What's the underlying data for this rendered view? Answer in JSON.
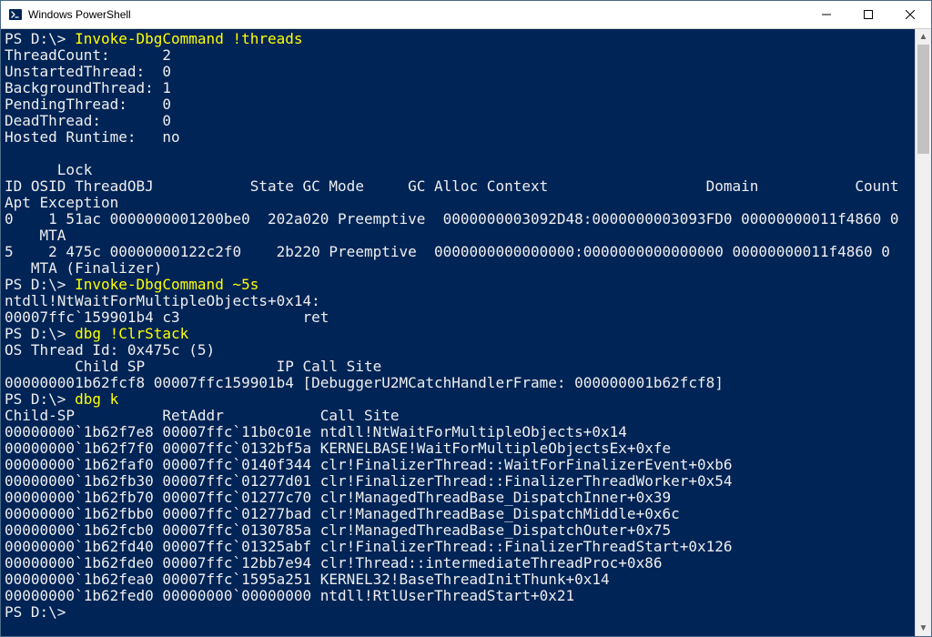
{
  "window": {
    "title": "Windows PowerShell"
  },
  "colors": {
    "terminal_bg": "#012456",
    "terminal_fg": "#eeeeee",
    "command_fg": "#ffff00"
  },
  "terminal": {
    "lines": [
      {
        "prompt": "PS D:\\> ",
        "cmd": "Invoke-DbgCommand !threads"
      },
      {
        "out": "ThreadCount:      2"
      },
      {
        "out": "UnstartedThread:  0"
      },
      {
        "out": "BackgroundThread: 1"
      },
      {
        "out": "PendingThread:    0"
      },
      {
        "out": "DeadThread:       0"
      },
      {
        "out": "Hosted Runtime:   no"
      },
      {
        "out": "                                                                                                             Lock "
      },
      {
        "out": "ID OSID ThreadOBJ           State GC Mode     GC Alloc Context                  Domain           Count Apt Exception"
      },
      {
        "out": "0    1 51ac 0000000001200be0  202a020 Preemptive  0000000003092D48:0000000003093FD0 00000000011f4860 0     MTA"
      },
      {
        "out": "5    2 475c 00000000122c2f0    2b220 Preemptive  0000000000000000:0000000000000000 00000000011f4860 0     MTA (Finalizer)"
      },
      {
        "prompt": "PS D:\\> ",
        "cmd": "Invoke-DbgCommand ~5s"
      },
      {
        "out": "ntdll!NtWaitForMultipleObjects+0x14:"
      },
      {
        "out": "00007ffc`159901b4 c3              ret"
      },
      {
        "prompt": "PS D:\\> ",
        "cmd": "dbg !ClrStack"
      },
      {
        "out": "OS Thread Id: 0x475c (5)"
      },
      {
        "out": "        Child SP               IP Call Site"
      },
      {
        "out": "000000001b62fcf8 00007ffc159901b4 [DebuggerU2MCatchHandlerFrame: 000000001b62fcf8]"
      },
      {
        "prompt": "PS D:\\> ",
        "cmd": "dbg k"
      },
      {
        "out": "Child-SP          RetAddr           Call Site"
      },
      {
        "out": "00000000`1b62f7e8 00007ffc`11b0c01e ntdll!NtWaitForMultipleObjects+0x14"
      },
      {
        "out": "00000000`1b62f7f0 00007ffc`0132bf5a KERNELBASE!WaitForMultipleObjectsEx+0xfe"
      },
      {
        "out": "00000000`1b62faf0 00007ffc`0140f344 clr!FinalizerThread::WaitForFinalizerEvent+0xb6"
      },
      {
        "out": "00000000`1b62fb30 00007ffc`01277d01 clr!FinalizerThread::FinalizerThreadWorker+0x54"
      },
      {
        "out": "00000000`1b62fb70 00007ffc`01277c70 clr!ManagedThreadBase_DispatchInner+0x39"
      },
      {
        "out": "00000000`1b62fbb0 00007ffc`01277bad clr!ManagedThreadBase_DispatchMiddle+0x6c"
      },
      {
        "out": "00000000`1b62fcb0 00007ffc`0130785a clr!ManagedThreadBase_DispatchOuter+0x75"
      },
      {
        "out": "00000000`1b62fd40 00007ffc`01325abf clr!FinalizerThread::FinalizerThreadStart+0x126"
      },
      {
        "out": "00000000`1b62fde0 00007ffc`12bb7e94 clr!Thread::intermediateThreadProc+0x86"
      },
      {
        "out": "00000000`1b62fea0 00007ffc`1595a251 KERNEL32!BaseThreadInitThunk+0x14"
      },
      {
        "out": "00000000`1b62fed0 00000000`00000000 ntdll!RtlUserThreadStart+0x21"
      },
      {
        "prompt": "PS D:\\>",
        "cmd": ""
      }
    ]
  }
}
